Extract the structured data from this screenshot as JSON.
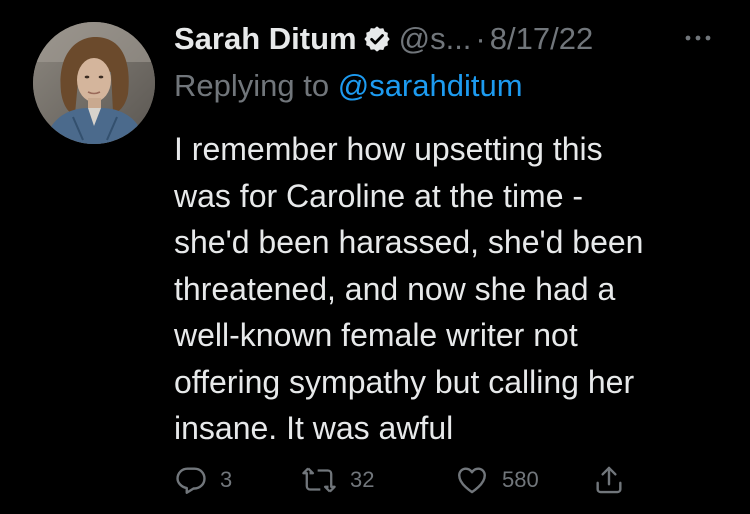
{
  "tweet": {
    "author": {
      "name": "Sarah Ditum",
      "handle": "@s...",
      "verified_icon": "verified-badge-icon"
    },
    "separator": "·",
    "date": "8/17/22",
    "more_icon": "more-dots-icon",
    "replying_to": {
      "prefix": "Replying to",
      "mention": "@sarahditum"
    },
    "body_lines": [
      "I remember how upsetting this",
      "was for Caroline at the time -",
      "she'd been harassed, she'd been",
      "threatened, and now she had a",
      "well-known female writer not",
      "offering sympathy but calling her",
      "insane. It was awful"
    ],
    "actions": {
      "reply": {
        "icon": "reply-icon",
        "count": "3"
      },
      "retweet": {
        "icon": "retweet-icon",
        "count": "32"
      },
      "like": {
        "icon": "heart-icon",
        "count": "580"
      },
      "share": {
        "icon": "share-icon"
      }
    }
  },
  "colors": {
    "background": "#000000",
    "text": "#e7e9ea",
    "secondary": "#71767b",
    "link": "#1d9bf0"
  }
}
